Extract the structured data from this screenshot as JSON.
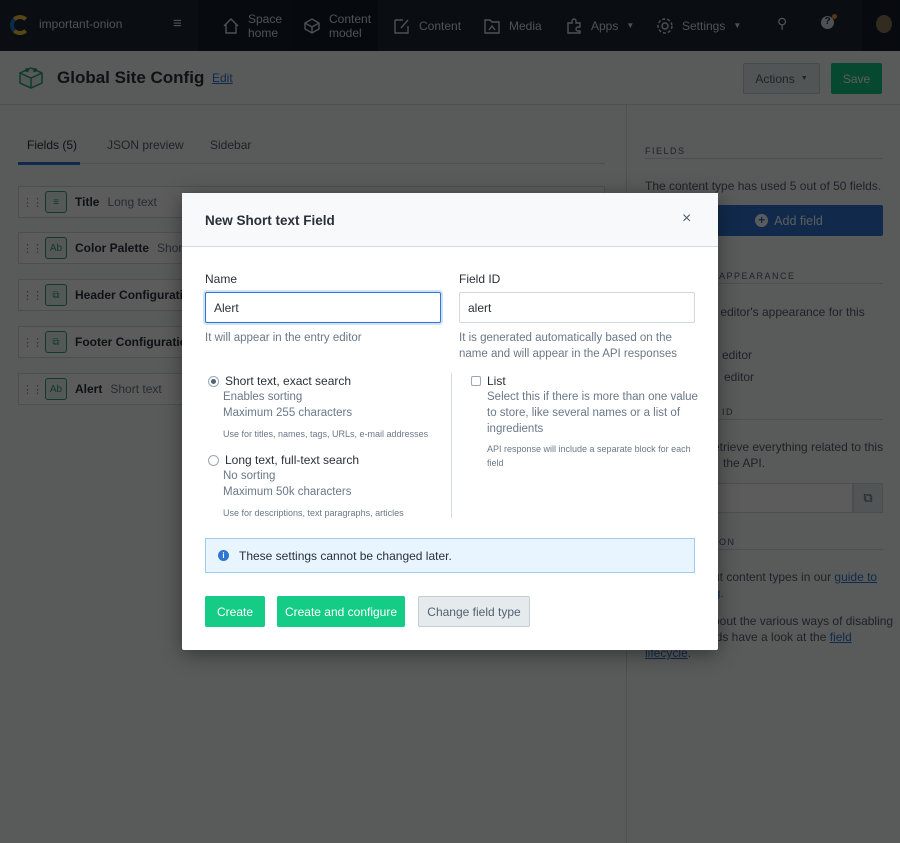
{
  "nav": {
    "space_name": "important-onion",
    "items": [
      {
        "label1": "Space",
        "label2": "home"
      },
      {
        "label1": "Content",
        "label2": "model"
      },
      {
        "label": "Content"
      },
      {
        "label": "Media"
      },
      {
        "label": "Apps"
      },
      {
        "label": "Settings"
      }
    ]
  },
  "header": {
    "title": "Global Site Config",
    "edit": "Edit",
    "actions": "Actions",
    "save": "Save"
  },
  "tabs": [
    "Fields (5)",
    "JSON preview",
    "Sidebar"
  ],
  "fields": [
    {
      "name": "Title",
      "type": "Long text",
      "icon": "≡"
    },
    {
      "name": "Color Palette",
      "type": "Short",
      "icon": "Ab"
    },
    {
      "name": "Header Configuration",
      "type": "",
      "icon": "⧉"
    },
    {
      "name": "Footer Configuration",
      "type": "",
      "icon": "⧉"
    },
    {
      "name": "Alert",
      "type": "Short text",
      "icon": "Ab"
    }
  ],
  "sidebar": {
    "fields_heading": "FIELDS",
    "fields_text": "The content type has used 5 out of 50 fields.",
    "add_field": "Add field",
    "appearance_heading": "APPEARANCE",
    "appearance_text": "ry editor's appearance for this",
    "editor1": "editor",
    "editor2": "editor",
    "id_heading": "ID",
    "id_text1": "etrieve everything related to this",
    "id_text2": "the API.",
    "doc_heading": "ON",
    "doc_text1": "ut content types in our ",
    "doc_link1": "guide to",
    "doc_link2": "ng",
    "doc_text2": ".",
    "doc_text3": "bout the various ways of disabling",
    "doc_text4": "lds have a look at the ",
    "doc_link3": "field",
    "doc_link4": "lifecycle",
    "doc_text5": "."
  },
  "modal": {
    "title": "New Short text Field",
    "name_label": "Name",
    "name_value": "Alert",
    "name_help": "It will appear in the entry editor",
    "id_label": "Field ID",
    "id_value": "alert",
    "id_help": "It is generated automatically based on the name and will appear in the API responses",
    "option1": {
      "title": "Short text, exact search",
      "line1": "Enables sorting",
      "line2": "Maximum 255 characters",
      "note": "Use for titles, names, tags, URLs, e-mail addresses",
      "selected": true
    },
    "option2": {
      "title": "Long text, full-text search",
      "line1": "No sorting",
      "line2": "Maximum 50k characters",
      "note": "Use for descriptions, text paragraphs, articles",
      "selected": false
    },
    "list": {
      "title": "List",
      "desc": "Select this if there is more than one value to store, like several names or a list of ingredients",
      "note": "API response will include a separate block for each field",
      "checked": false
    },
    "info": "These settings cannot be changed later.",
    "create": "Create",
    "create_configure": "Create and configure",
    "change_type": "Change field type"
  }
}
